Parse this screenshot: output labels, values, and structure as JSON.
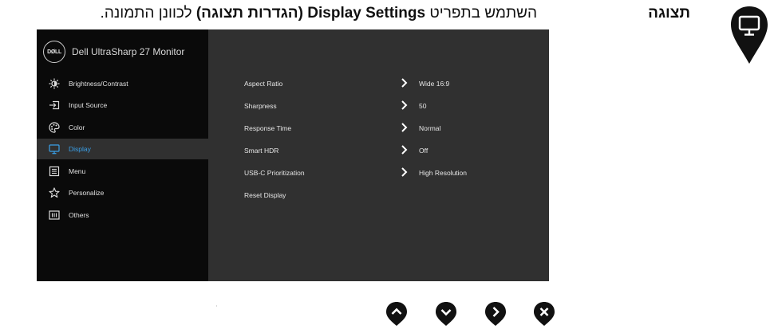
{
  "instruction": {
    "prefix": "השתמש בתפריט ",
    "bold": "Display Settings (הגדרות תצוגה)",
    "suffix": " לכוונן התמונה."
  },
  "section": {
    "title": "תצוגה",
    "icon": "monitor-icon"
  },
  "osd": {
    "logo_text": "DØLL",
    "title": "Dell UltraSharp 27 Monitor",
    "menu": [
      {
        "label": "Brightness/Contrast",
        "icon": "brightness-icon",
        "active": false
      },
      {
        "label": "Input Source",
        "icon": "input-source-icon",
        "active": false
      },
      {
        "label": "Color",
        "icon": "palette-icon",
        "active": false
      },
      {
        "label": "Display",
        "icon": "monitor-icon",
        "active": true
      },
      {
        "label": "Menu",
        "icon": "menu-list-icon",
        "active": false
      },
      {
        "label": "Personalize",
        "icon": "star-icon",
        "active": false
      },
      {
        "label": "Others",
        "icon": "others-icon",
        "active": false
      }
    ],
    "settings": [
      {
        "label": "Aspect Ratio",
        "value": "Wide 16:9"
      },
      {
        "label": "Sharpness",
        "value": "50"
      },
      {
        "label": "Response Time",
        "value": "Normal"
      },
      {
        "label": "Smart HDR",
        "value": "Off"
      },
      {
        "label": "USB-C Prioritization",
        "value": "High Resolution"
      },
      {
        "label": "Reset Display",
        "value": ""
      }
    ]
  },
  "buttons": [
    {
      "name": "up-button",
      "icon": "chevron-up-icon"
    },
    {
      "name": "down-button",
      "icon": "chevron-down-icon"
    },
    {
      "name": "right-button",
      "icon": "chevron-right-icon"
    },
    {
      "name": "exit-button",
      "icon": "close-icon"
    }
  ],
  "colors": {
    "osd_sidebar": "#0a0a0a",
    "osd_panel": "#303030",
    "active_text": "#3aa0e8",
    "pin": "#111111"
  }
}
